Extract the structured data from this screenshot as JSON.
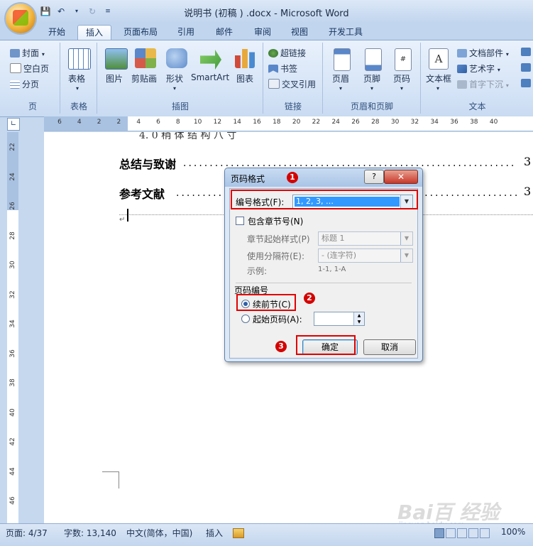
{
  "window": {
    "title": "说明书 (初稿 ) .docx - Microsoft Word"
  },
  "tabs": [
    "开始",
    "插入",
    "页面布局",
    "引用",
    "邮件",
    "审阅",
    "视图",
    "开发工具"
  ],
  "active_tab": "插入",
  "ribbon": {
    "pages_group": {
      "label": "页",
      "items": [
        "封面",
        "空白页",
        "分页"
      ]
    },
    "table_group": {
      "label": "表格",
      "button": "表格"
    },
    "illustrations_group": {
      "label": "插图",
      "items": [
        "图片",
        "剪贴画",
        "形状",
        "SmartArt",
        "图表"
      ]
    },
    "links_group": {
      "label": "链接",
      "items": [
        "超链接",
        "书签",
        "交叉引用"
      ]
    },
    "header_footer_group": {
      "label": "页眉和页脚",
      "items": [
        "页眉",
        "页脚",
        "页码"
      ]
    },
    "text_group": {
      "label": "文本",
      "items": [
        "文本框",
        "文档部件",
        "艺术字",
        "首字下沉"
      ]
    }
  },
  "hruler": {
    "marks": [
      "6",
      "4",
      "2",
      "2",
      "4",
      "6",
      "8",
      "10",
      "12",
      "14",
      "16",
      "18",
      "20",
      "22",
      "24",
      "26",
      "28",
      "30",
      "32",
      "34",
      "36",
      "38",
      "40"
    ]
  },
  "vruler": {
    "marks": [
      "22",
      "24",
      "26",
      "28",
      "30",
      "32",
      "34",
      "36",
      "38",
      "40",
      "42",
      "44",
      "46"
    ]
  },
  "document": {
    "partial_line": "4. 0 稍 体 结 构 八 寸",
    "toc": [
      {
        "title": "总结与致谢",
        "page": "3"
      },
      {
        "title": "参考文献",
        "page": "3"
      }
    ]
  },
  "dialog": {
    "title": "页码格式",
    "number_format_label": "编号格式(F):",
    "number_format_value": "1, 2, 3, …",
    "include_chapter_label": "包含章节号(N)",
    "chapter_style_label": "章节起始样式(P)",
    "chapter_style_value": "标题 1",
    "separator_label": "使用分隔符(E):",
    "separator_value": "-  (连字符)",
    "example_label": "示例:",
    "example_value": "1-1, 1-A",
    "numbering_section_label": "页码编号",
    "continue_label": "续前节(C)",
    "start_at_label": "起始页码(A):",
    "ok_label": "确定",
    "cancel_label": "取消",
    "help_label": "?",
    "close_label": "✕",
    "badges": [
      "1",
      "2",
      "3"
    ]
  },
  "statusbar": {
    "page": "页面: 4/37",
    "words": "字数: 13,140",
    "language": "中文(简体，中国)",
    "mode": "插入",
    "zoom": "100%"
  },
  "watermark": {
    "text": "Bai百 经验",
    "url": "jingyan.baidu.com"
  },
  "colors": {
    "highlight_red": "#e00000",
    "selection_blue": "#3399ff",
    "ribbon_blue": "#c1d5ee"
  }
}
